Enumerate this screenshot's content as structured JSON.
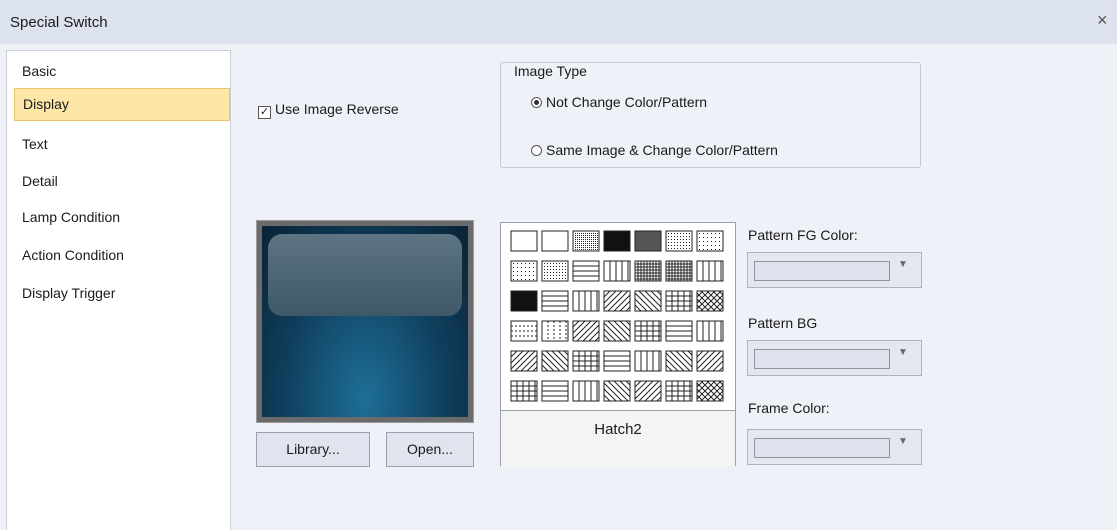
{
  "dialog": {
    "title": "Special Switch",
    "close_glyph": "×"
  },
  "sidebar": {
    "items": [
      {
        "label": "Basic",
        "selected": false
      },
      {
        "label": "Display",
        "selected": true
      },
      {
        "label": "Text",
        "selected": false
      },
      {
        "label": "Detail",
        "selected": false
      },
      {
        "label": "Lamp Condition",
        "selected": false
      },
      {
        "label": "Action Condition",
        "selected": false
      },
      {
        "label": "Display Trigger",
        "selected": false
      }
    ]
  },
  "display": {
    "use_image_reverse": {
      "label": "Use Image Reverse",
      "checked": true
    },
    "image_type": {
      "title": "Image Type",
      "options": [
        {
          "label": "Not Change Color/Pattern",
          "selected": true
        },
        {
          "label": "Same Image & Change Color/Pattern",
          "selected": false
        }
      ]
    },
    "library_button": "Library...",
    "open_button": "Open...",
    "pattern": {
      "selected_name": "Hatch2"
    },
    "pattern_fg_color": {
      "label": "Pattern FG Color:",
      "value_color": "#dde2ec"
    },
    "pattern_bg": {
      "label": "Pattern BG",
      "value_color": "#dde2ec"
    },
    "frame_color": {
      "label": "Frame Color:",
      "value_color": "#dde2ec"
    }
  },
  "colors": {
    "selected_nav": "#fde6a6",
    "background": "#eef1f7",
    "titlebar": "#dde3ee"
  }
}
